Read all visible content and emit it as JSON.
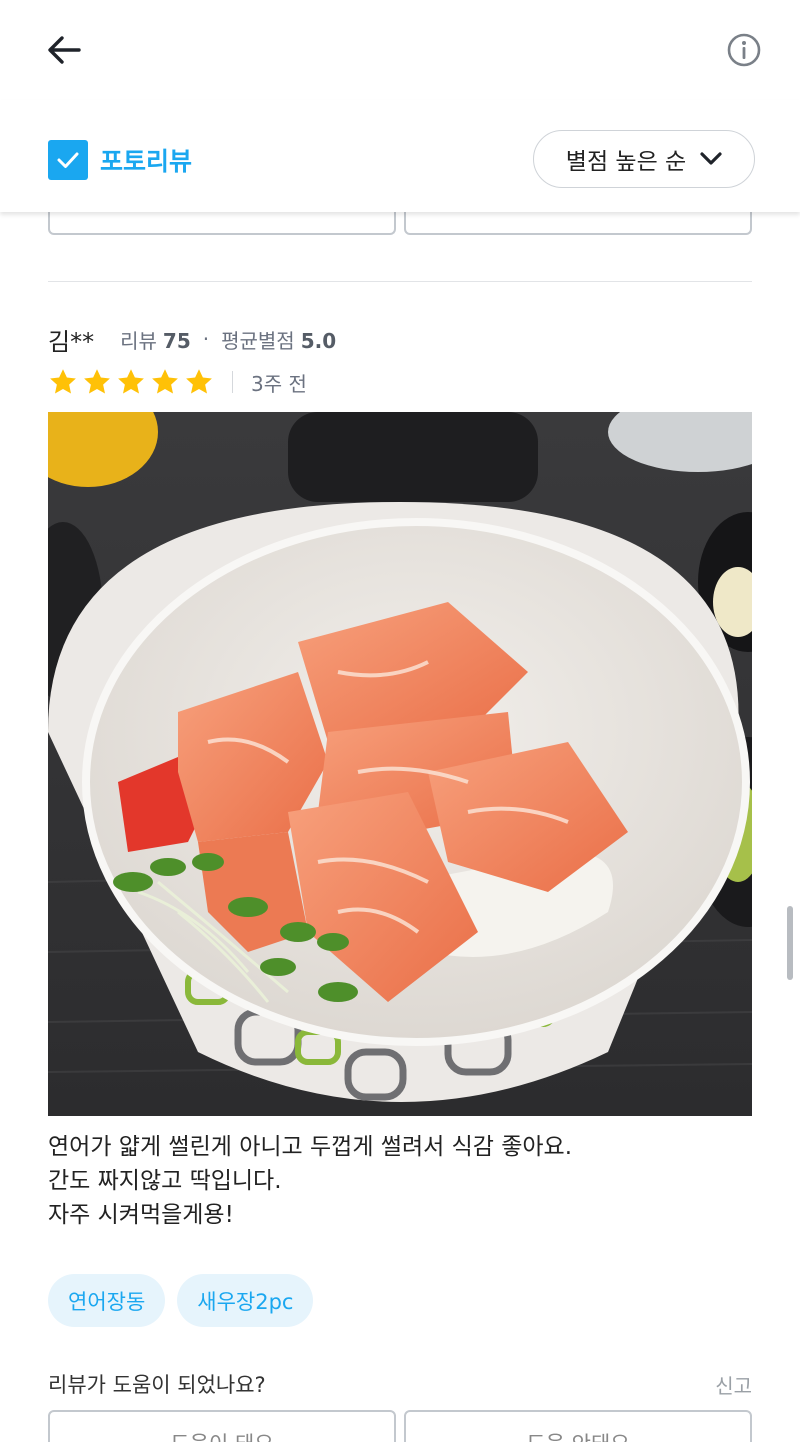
{
  "header": {
    "back_icon": "arrow-left-icon",
    "info_icon": "info-circle-icon"
  },
  "filter": {
    "photo_only_label": "포토리뷰",
    "photo_only_checked": true,
    "sort_label": "별점 높은 순",
    "accent_color": "#1aa7f0"
  },
  "review": {
    "author": "김**",
    "review_count_label": "리뷰",
    "review_count": "75",
    "separator": "·",
    "avg_rating_label": "평균별점",
    "avg_rating": "5.0",
    "stars": 5,
    "star_color": "#ffc107",
    "date": "3주 전",
    "text_lines": [
      "연어가 얇게 썰린게 아니고 두껍게 썰려서 식감 좋아요.",
      "간도 짜지않고 딱입니다.",
      "자주 시켜먹을게용!"
    ],
    "tags": [
      "연어장동",
      "새우장2pc"
    ]
  },
  "helpful": {
    "question": "리뷰가 도움이 되었나요?",
    "report": "신고",
    "yes": "도움이 돼요",
    "no": "도움 안돼요"
  }
}
